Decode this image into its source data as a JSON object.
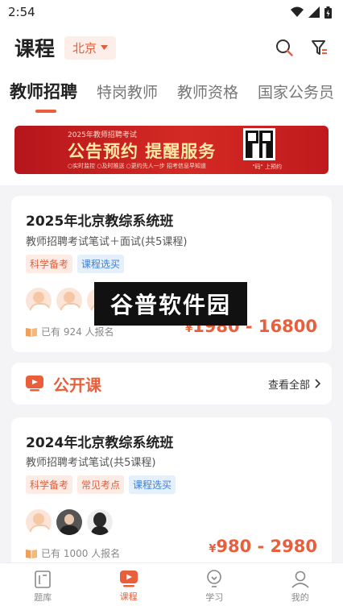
{
  "status_bar": {
    "time": "2:54"
  },
  "header": {
    "title": "课程",
    "city": "北京"
  },
  "tabs": [
    {
      "label": "教师招聘",
      "active": true
    },
    {
      "label": "特岗教师",
      "active": false
    },
    {
      "label": "教师资格",
      "active": false
    },
    {
      "label": "国家公务员",
      "active": false
    }
  ],
  "banner": {
    "subtitle": "2025年教师招聘考试",
    "title": "公告预约 提醒服务",
    "tags": "○实时监控  ○及时推送  ○更约先人一步 招考信息早知道",
    "qr_caption": "\"码\" 上预约"
  },
  "courses": [
    {
      "title": "2025年北京教综系统班",
      "subtitle": "教师招聘考试笔试＋面试(共5课程)",
      "tags": [
        {
          "label": "科学备考",
          "color": "orange"
        },
        {
          "label": "课程选买",
          "color": "blue"
        }
      ],
      "enrolled": "已有 924 人报名",
      "price_symbol": "¥",
      "price": "1980 - 16800"
    },
    {
      "title": "2024年北京教综系统班",
      "subtitle": "教师招聘考试笔试(共5课程)",
      "tags": [
        {
          "label": "科学备考",
          "color": "orange"
        },
        {
          "label": "常见考点",
          "color": "orange"
        },
        {
          "label": "课程选买",
          "color": "blue"
        }
      ],
      "enrolled": "已有 1000 人报名",
      "price_symbol": "¥",
      "price": "980 - 2980"
    }
  ],
  "open_class": {
    "title": "公开课",
    "view_all": "查看全部"
  },
  "watermark": "谷普软件园",
  "bottom_nav": [
    {
      "label": "题库",
      "active": false
    },
    {
      "label": "课程",
      "active": true
    },
    {
      "label": "学习",
      "active": false
    },
    {
      "label": "我的",
      "active": false
    }
  ],
  "colors": {
    "accent": "#e95f3c",
    "tag_orange_bg": "#fdece6",
    "tag_blue_bg": "#e5f0fc"
  }
}
